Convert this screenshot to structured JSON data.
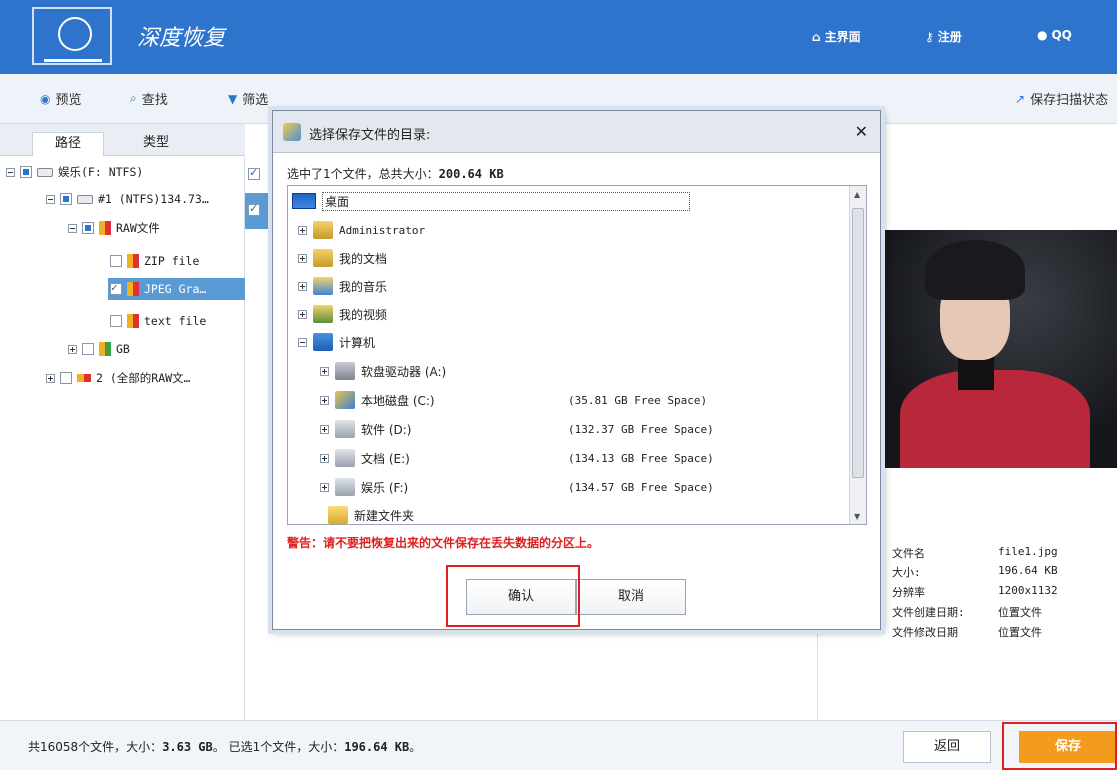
{
  "header": {
    "app_title": "深度恢复",
    "nav": [
      {
        "label": "主界面",
        "icon": "home-icon"
      },
      {
        "label": "注册",
        "icon": "key-icon"
      },
      {
        "label": "QQ",
        "icon": "qq-icon"
      }
    ]
  },
  "toolbar": {
    "preview": "预览",
    "search": "查找",
    "filter": "筛选",
    "save_scan_state": "保存扫描状态"
  },
  "left_tabs": [
    "路径",
    "类型"
  ],
  "tree": [
    {
      "label": "娱乐(F: NTFS)"
    },
    {
      "label": "#1  (NTFS)134.73…"
    },
    {
      "label": "RAW文件"
    },
    {
      "label": "ZIP file"
    },
    {
      "label": "JPEG Gra…"
    },
    {
      "label": "text file"
    },
    {
      "label": "GB"
    },
    {
      "label": "2  (全部的RAW文…"
    }
  ],
  "preview_info": {
    "labels": [
      "文件名",
      "大小:",
      "分辨率",
      "文件创建日期:",
      "文件修改日期"
    ],
    "values": [
      "file1.jpg",
      "196.64 KB",
      "1200x1132",
      "位置文件",
      "位置文件"
    ]
  },
  "footer": {
    "status_prefix": "共16058个文件，大小：",
    "status_size": "3.63 GB",
    "status_mid": "。 已选1个文件，大小：",
    "status_sel": "196.64 KB",
    "status_end": "。",
    "back": "返回",
    "save": "保存"
  },
  "dialog": {
    "title": "选择保存文件的目录:",
    "summary_prefix": "选中了1个文件，总共大小：",
    "summary_size": "200.64 KB",
    "root": "桌面",
    "items": [
      {
        "label": "Administrator",
        "free": ""
      },
      {
        "label": "我的文档",
        "free": ""
      },
      {
        "label": "我的音乐",
        "free": ""
      },
      {
        "label": "我的视频",
        "free": ""
      },
      {
        "label": "计算机",
        "free": ""
      },
      {
        "label": "软盘驱动器 (A:)",
        "free": ""
      },
      {
        "label": "本地磁盘 (C:)",
        "free": "(35.81 GB Free Space)"
      },
      {
        "label": "软件 (D:)",
        "free": "(132.37 GB Free Space)"
      },
      {
        "label": "文档 (E:)",
        "free": "(134.13 GB Free Space)"
      },
      {
        "label": "娱乐 (F:)",
        "free": "(134.57 GB Free Space)"
      },
      {
        "label": "新建文件夹",
        "free": ""
      }
    ],
    "warning": "警告：请不要把恢复出来的文件保存在丢失数据的分区上。",
    "ok": "确认",
    "cancel": "取消"
  }
}
